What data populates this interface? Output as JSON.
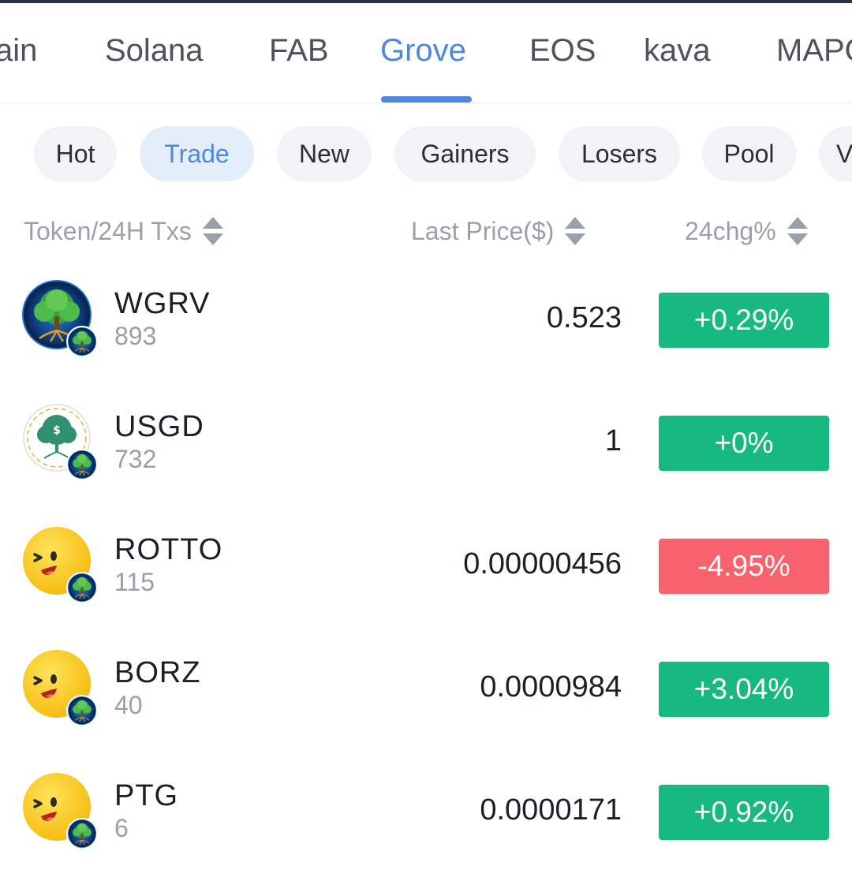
{
  "chain_tabs": [
    "ain",
    "Solana",
    "FAB",
    "Grove",
    "EOS",
    "kava",
    "MAPO"
  ],
  "active_chain": "Grove",
  "filters": [
    "Hot",
    "Trade",
    "New",
    "Gainers",
    "Losers",
    "Pool",
    "V"
  ],
  "active_filter": "Trade",
  "columns": {
    "token": "Token/24H Txs",
    "price": "Last Price($)",
    "change": "24chg%"
  },
  "tokens": [
    {
      "symbol": "WGRV",
      "txs": "893",
      "price": "0.523",
      "change": "+0.29%",
      "direction": "up",
      "icon": "grove-tree-icon"
    },
    {
      "symbol": "USGD",
      "txs": "732",
      "price": "1",
      "change": "+0%",
      "direction": "up",
      "icon": "dollar-tree-icon"
    },
    {
      "symbol": "ROTTO",
      "txs": "115",
      "price": "0.00000456",
      "change": "-4.95%",
      "direction": "down",
      "icon": "wink-face-icon"
    },
    {
      "symbol": "BORZ",
      "txs": "40",
      "price": "0.0000984",
      "change": "+3.04%",
      "direction": "up",
      "icon": "wink-face-icon"
    },
    {
      "symbol": "PTG",
      "txs": "6",
      "price": "0.0000171",
      "change": "+0.92%",
      "direction": "up",
      "icon": "wink-face-icon"
    }
  ],
  "colors": {
    "accent": "#4f87df",
    "up": "#17b981",
    "down": "#f8626d"
  }
}
